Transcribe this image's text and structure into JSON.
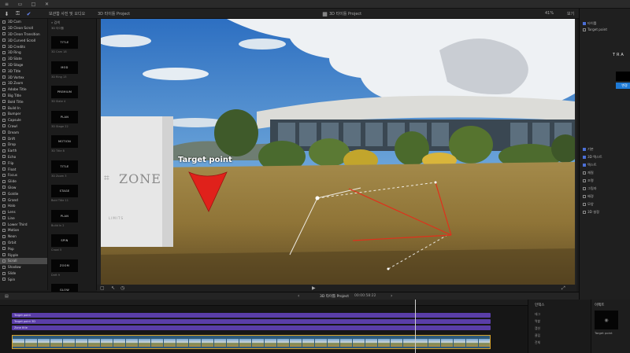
{
  "sysbar": {
    "icons": [
      "menu-icon",
      "minimize-icon",
      "maximize-icon",
      "close-icon"
    ]
  },
  "toolbar": {
    "library_label": "보관함 사진 및 오디오",
    "event_label": "3D 타이틀 Project",
    "project_label": "3D 타이틀 Project",
    "view_label": "보기",
    "zoom_label": "41%"
  },
  "browser": {
    "search_placeholder": "검색",
    "items": [
      "3D Cam",
      "3D Clean Scroll",
      "3D Clean Transition",
      "3D Curved Scroll",
      "3D Credits",
      "3D Ring",
      "3D Slate",
      "3D Stage",
      "3D Title",
      "3D Vortex",
      "3D Zoom",
      "Adobe Title",
      "Big Title",
      "Bold Title",
      "Build In",
      "Bumper",
      "Capsule",
      "Crawl",
      "Dream",
      "Drift",
      "Drop",
      "Earth",
      "Echo",
      "Flip",
      "Float",
      "Focus",
      "Glide",
      "Glow",
      "Goldie",
      "Grand",
      "Halo",
      "Lens",
      "Line",
      "Lower Third",
      "Motion",
      "Neon",
      "Orbit",
      "Pop",
      "Ripple",
      "Scroll",
      "Shadow",
      "Slide",
      "Spin"
    ],
    "selected_index": 39
  },
  "thumbs": {
    "header": "3D 타이틀",
    "items": [
      {
        "label": "TITLE",
        "caption": "3D Cam 18"
      },
      {
        "label": "MOD",
        "caption": "3D Ring 13"
      },
      {
        "label": "PREMIUM",
        "caption": "3D Slate 4"
      },
      {
        "label": "PLAN",
        "caption": "3D Stage 22"
      },
      {
        "label": "MOTION",
        "caption": "3D Title 8"
      },
      {
        "label": "TITLE",
        "caption": "3D Zoom 3"
      },
      {
        "label": "STAGE",
        "caption": "Bold Title 11"
      },
      {
        "label": "PLAN",
        "caption": "Build In 2"
      },
      {
        "label": "SPIN",
        "caption": "Crawl 5"
      },
      {
        "label": "ZOOM",
        "caption": "Drift 9"
      },
      {
        "label": "GLOW",
        "caption": "Focus 6"
      }
    ]
  },
  "viewer": {
    "overlay_title": "Target point",
    "sign_text": "ZONE",
    "sign_sub": "LIMITS"
  },
  "inspector": {
    "title": "TRA",
    "subtitle": "타이틀",
    "rows": [
      "기본",
      "3D 텍스트",
      "텍스트",
      "재질",
      "조명",
      "그림자",
      "배경",
      "모양",
      "3D 설정"
    ],
    "button_label": "변경"
  },
  "timeline": {
    "header_label": "3D 타이틀 Project",
    "timecode": "00:00:58:22",
    "tracks": [
      "Target point",
      "Target point 3D",
      "Zone title"
    ],
    "index_label": "인덱스",
    "index_rows": [
      "태그",
      "역할",
      "캡션",
      "클립",
      "전체"
    ],
    "effects_label": "이펙트",
    "effects_item": "Target point"
  },
  "colors": {
    "accent": "#4b6fd6",
    "title_track": "#5a3ea8",
    "clip_border": "#d7a22a",
    "arrow_red": "#e0211b"
  }
}
